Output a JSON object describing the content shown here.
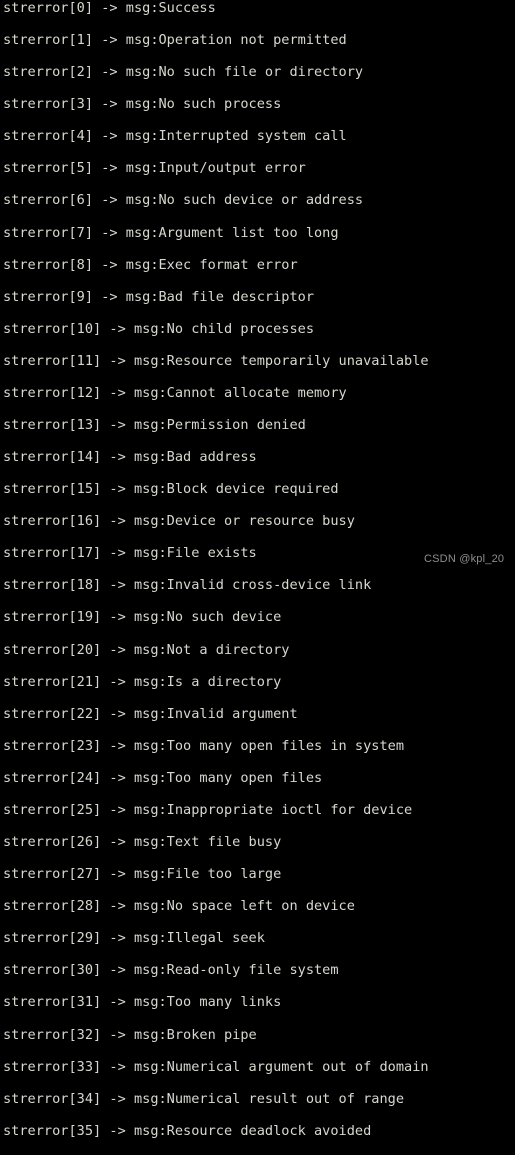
{
  "terminal": {
    "background_color": "#000000",
    "text_color": "#d8d8d0",
    "prefix": "strerror",
    "arrow": "->",
    "msg_label": "msg:",
    "lines": [
      "strerror[0] -> msg:Success",
      "strerror[1] -> msg:Operation not permitted",
      "strerror[2] -> msg:No such file or directory",
      "strerror[3] -> msg:No such process",
      "strerror[4] -> msg:Interrupted system call",
      "strerror[5] -> msg:Input/output error",
      "strerror[6] -> msg:No such device or address",
      "strerror[7] -> msg:Argument list too long",
      "strerror[8] -> msg:Exec format error",
      "strerror[9] -> msg:Bad file descriptor",
      "strerror[10] -> msg:No child processes",
      "strerror[11] -> msg:Resource temporarily unavailable",
      "strerror[12] -> msg:Cannot allocate memory",
      "strerror[13] -> msg:Permission denied",
      "strerror[14] -> msg:Bad address",
      "strerror[15] -> msg:Block device required",
      "strerror[16] -> msg:Device or resource busy",
      "strerror[17] -> msg:File exists",
      "strerror[18] -> msg:Invalid cross-device link",
      "strerror[19] -> msg:No such device",
      "strerror[20] -> msg:Not a directory",
      "strerror[21] -> msg:Is a directory",
      "strerror[22] -> msg:Invalid argument",
      "strerror[23] -> msg:Too many open files in system",
      "strerror[24] -> msg:Too many open files",
      "strerror[25] -> msg:Inappropriate ioctl for device",
      "strerror[26] -> msg:Text file busy",
      "strerror[27] -> msg:File too large",
      "strerror[28] -> msg:No space left on device",
      "strerror[29] -> msg:Illegal seek",
      "strerror[30] -> msg:Read-only file system",
      "strerror[31] -> msg:Too many links",
      "strerror[32] -> msg:Broken pipe",
      "strerror[33] -> msg:Numerical argument out of domain",
      "strerror[34] -> msg:Numerical result out of range",
      "strerror[35] -> msg:Resource deadlock avoided"
    ],
    "entries": [
      {
        "index": "0",
        "message": "Success"
      },
      {
        "index": "1",
        "message": "Operation not permitted"
      },
      {
        "index": "2",
        "message": "No such file or directory"
      },
      {
        "index": "3",
        "message": "No such process"
      },
      {
        "index": "4",
        "message": "Interrupted system call"
      },
      {
        "index": "5",
        "message": "Input/output error"
      },
      {
        "index": "6",
        "message": "No such device or address"
      },
      {
        "index": "7",
        "message": "Argument list too long"
      },
      {
        "index": "8",
        "message": "Exec format error"
      },
      {
        "index": "9",
        "message": "Bad file descriptor"
      },
      {
        "index": "10",
        "message": "No child processes"
      },
      {
        "index": "11",
        "message": "Resource temporarily unavailable"
      },
      {
        "index": "12",
        "message": "Cannot allocate memory"
      },
      {
        "index": "13",
        "message": "Permission denied"
      },
      {
        "index": "14",
        "message": "Bad address"
      },
      {
        "index": "15",
        "message": "Block device required"
      },
      {
        "index": "16",
        "message": "Device or resource busy"
      },
      {
        "index": "17",
        "message": "File exists"
      },
      {
        "index": "18",
        "message": "Invalid cross-device link"
      },
      {
        "index": "19",
        "message": "No such device"
      },
      {
        "index": "20",
        "message": "Not a directory"
      },
      {
        "index": "21",
        "message": "Is a directory"
      },
      {
        "index": "22",
        "message": "Invalid argument"
      },
      {
        "index": "23",
        "message": "Too many open files in system"
      },
      {
        "index": "24",
        "message": "Too many open files"
      },
      {
        "index": "25",
        "message": "Inappropriate ioctl for device"
      },
      {
        "index": "26",
        "message": "Text file busy"
      },
      {
        "index": "27",
        "message": "File too large"
      },
      {
        "index": "28",
        "message": "No space left on device"
      },
      {
        "index": "29",
        "message": "Illegal seek"
      },
      {
        "index": "30",
        "message": "Read-only file system"
      },
      {
        "index": "31",
        "message": "Too many links"
      },
      {
        "index": "32",
        "message": "Broken pipe"
      },
      {
        "index": "33",
        "message": "Numerical argument out of domain"
      },
      {
        "index": "34",
        "message": "Numerical result out of range"
      },
      {
        "index": "35",
        "message": "Resource deadlock avoided"
      }
    ]
  },
  "watermark": {
    "text": "CSDN @kpl_20",
    "color": "#8e8e8e"
  }
}
